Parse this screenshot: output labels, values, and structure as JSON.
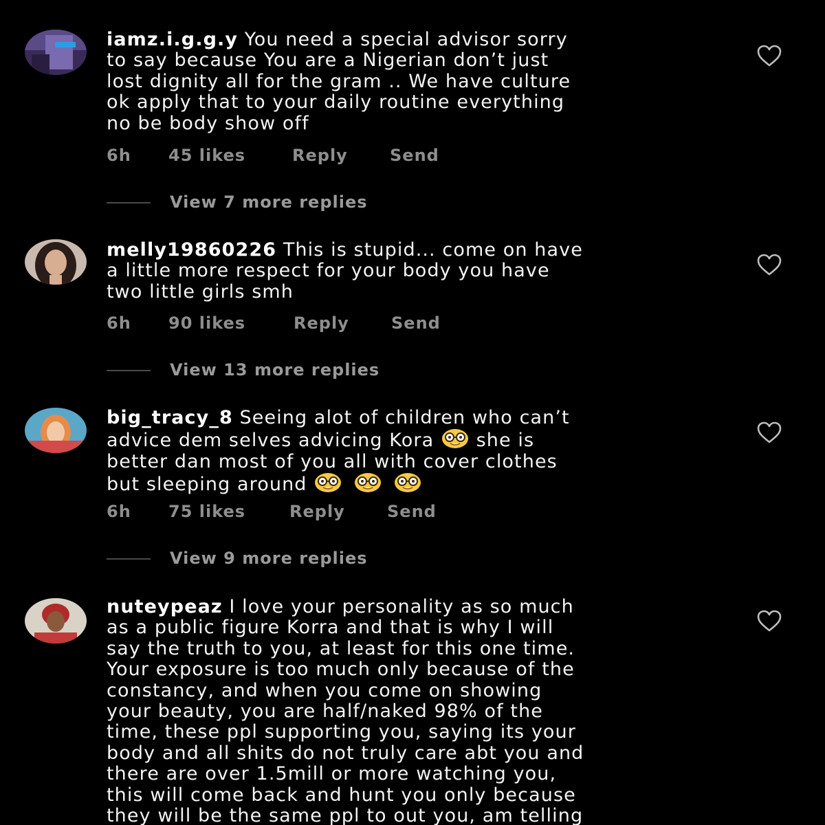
{
  "comments": [
    {
      "username": "iamz.i.g.g.y",
      "text": " You need a special advisor sorry\nto say because You are a Nigerian don’t just\nlost dignity all for the gram .. We have culture\nok apply that to your daily routine everything\nno be body show off",
      "time": "6h",
      "likes": "45 likes",
      "reply": "Reply",
      "send": "Send",
      "view_replies": "View 7 more replies"
    },
    {
      "username": "melly19860226",
      "text": " This is stupid... come on have\na little more respect for your body you have\ntwo little girls smh",
      "time": "6h",
      "likes": "90 likes",
      "reply": "Reply",
      "send": "Send",
      "view_replies": "View 13 more replies"
    },
    {
      "username": "big_tracy_8",
      "text_1": " Seeing alot of children who can’t\nadvice dem selves advicing Kora ",
      "text_2": "  she is\nbetter dan most of  you all with cover clothes\nbut sleeping around ",
      "time": "6h",
      "likes": "75 likes",
      "reply": "Reply",
      "send": "Send",
      "view_replies": "View 9 more replies"
    },
    {
      "username": "nuteypeaz",
      "text": " I love your personality as so much\nas a public figure Korra and that is why I will\nsay the truth to you, at least for this one time.\nYour exposure is too much only because of the\nconstancy, and when you come on showing\nyour beauty, you are half/naked 98% of the\ntime, these ppl supporting you, saying its your\nbody and all shits do not truly care abt you and\nthere are over 1.5mill or more watching you,\nthis will come back and hunt you only because\nthey will be the same ppl to out you, am telling"
    }
  ],
  "icons": {
    "like": "heart-outline-icon",
    "emoji": "nerd-face-emoji"
  },
  "colors": {
    "background": "#000000",
    "text": "#f4f4f4",
    "meta": "#8e8e8e"
  }
}
